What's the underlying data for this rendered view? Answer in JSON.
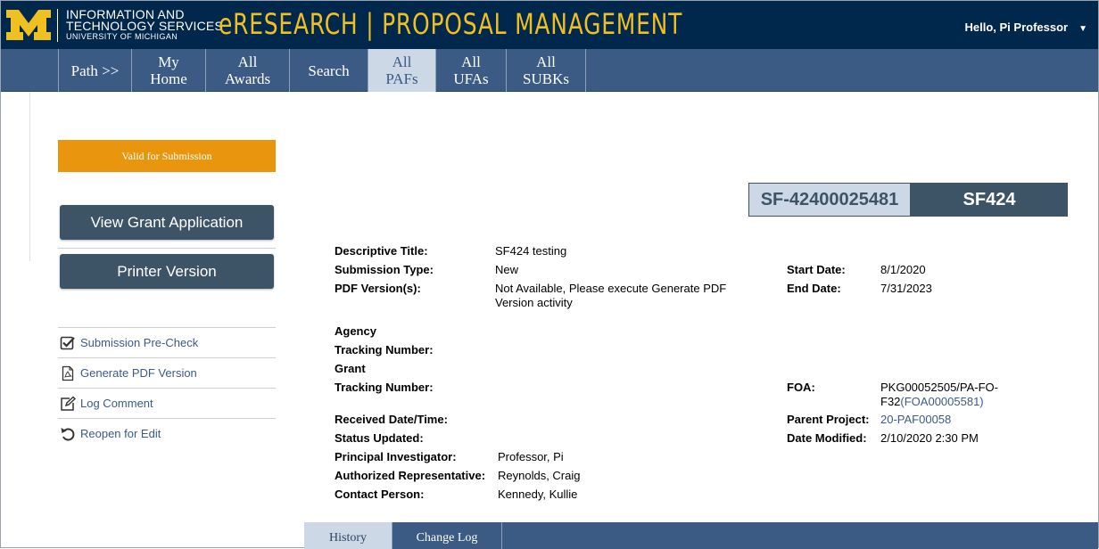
{
  "header": {
    "its_line1": "INFORMATION AND",
    "its_line2": "TECHNOLOGY SERVICES",
    "its_line3": "UNIVERSITY OF MICHIGAN",
    "app_title": "eRESEARCH | PROPOSAL MANAGEMENT",
    "user_greeting": "Hello, Pi Professor",
    "brand_color": "#00274c",
    "accent_color": "#f0c020"
  },
  "nav": {
    "items": [
      {
        "line1": "Path >>",
        "line2": ""
      },
      {
        "line1": "My",
        "line2": "Home"
      },
      {
        "line1": "All",
        "line2": "Awards"
      },
      {
        "line1": "Search",
        "line2": ""
      },
      {
        "line1": "All",
        "line2": "PAFs"
      },
      {
        "line1": "All",
        "line2": "UFAs"
      },
      {
        "line1": "All",
        "line2": "SUBKs"
      }
    ],
    "active_index": 4
  },
  "sidebar": {
    "status_banner": "Valid for Submission",
    "view_button": "View Grant Application",
    "printer_button": "Printer Version",
    "actions": [
      {
        "label": "Submission Pre-Check",
        "icon": "checkbox-icon"
      },
      {
        "label": "Generate PDF Version",
        "icon": "pdf-icon"
      },
      {
        "label": "Log Comment",
        "icon": "edit-icon"
      },
      {
        "label": "Reopen for Edit",
        "icon": "undo-icon"
      }
    ]
  },
  "record": {
    "id": "SF-42400025481",
    "type": "SF424"
  },
  "details": {
    "descriptive_title": {
      "label": "Descriptive Title:",
      "value": "SF424 testing"
    },
    "submission_type": {
      "label": "Submission Type:",
      "value": "New"
    },
    "pdf_version": {
      "label": "PDF Version(s):",
      "value": "Not Available, Please execute Generate PDF Version activity"
    },
    "agency_tracking": {
      "label1": "Agency",
      "label2": "Tracking Number:"
    },
    "grant_tracking": {
      "label1": "Grant",
      "label2": "Tracking Number:"
    },
    "received": {
      "label": "Received Date/Time:"
    },
    "status_updated": {
      "label": "Status Updated:"
    },
    "pi": {
      "label": "Principal Investigator:",
      "value": "Professor, Pi"
    },
    "auth_rep": {
      "label": "Authorized Representative:",
      "value": "Reynolds, Craig"
    },
    "contact": {
      "label": "Contact Person:",
      "value": "Kennedy, Kullie"
    },
    "start_date": {
      "label": "Start Date:",
      "value": "8/1/2020"
    },
    "end_date": {
      "label": "End Date:",
      "value": "7/31/2023"
    },
    "foa": {
      "label": "FOA:",
      "value_line1": "PKG00052505/PA-FO-",
      "value_line2": "F32",
      "value_link": "(FOA00005581)"
    },
    "parent_project": {
      "label": "Parent Project:",
      "value": "20-PAF00058"
    },
    "date_modified": {
      "label": "Date Modified:",
      "value": "2/10/2020 2:30 PM"
    }
  },
  "tabs": [
    {
      "label": "History"
    },
    {
      "label": "Change Log"
    }
  ]
}
